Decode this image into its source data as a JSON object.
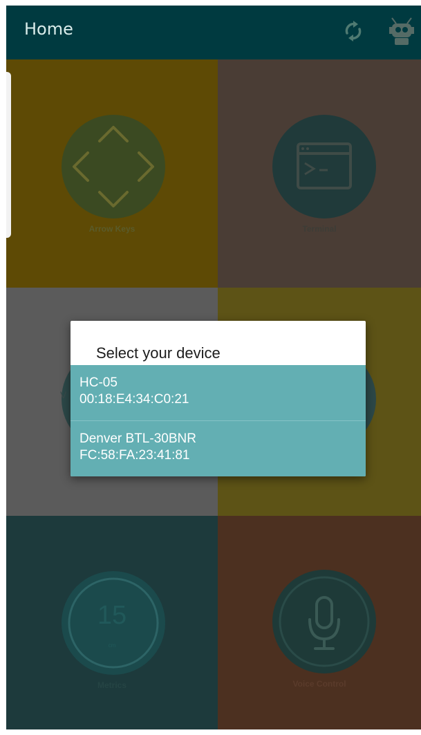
{
  "app_bar": {
    "title": "Home",
    "refresh_icon": "refresh-icon",
    "robot_icon": "robot-icon"
  },
  "tiles": [
    {
      "label": "Arrow Keys",
      "icon": "arrows-icon",
      "color": "#5e4a05"
    },
    {
      "label": "Terminal",
      "icon": "terminal-icon",
      "color": "#4a3d35"
    },
    {
      "label": "",
      "icon": "",
      "color": "#5b5b5b"
    },
    {
      "label": "",
      "icon": "",
      "color": "#5d5316"
    },
    {
      "label": "Metrics",
      "icon": "gauge-icon",
      "value": "15",
      "unit": "cm",
      "color": "#1d3a3c"
    },
    {
      "label": "Voice Control",
      "icon": "microphone-icon",
      "color": "#4c3020"
    }
  ],
  "partial_text_behind_dialog": "V",
  "dialog": {
    "title": "Select your device",
    "devices": [
      {
        "name": "HC-05",
        "address": "00:18:E4:34:C0:21"
      },
      {
        "name": "Denver BTL-30BNR",
        "address": "FC:58:FA:23:41:81"
      }
    ],
    "list_color": "#63afb3"
  }
}
